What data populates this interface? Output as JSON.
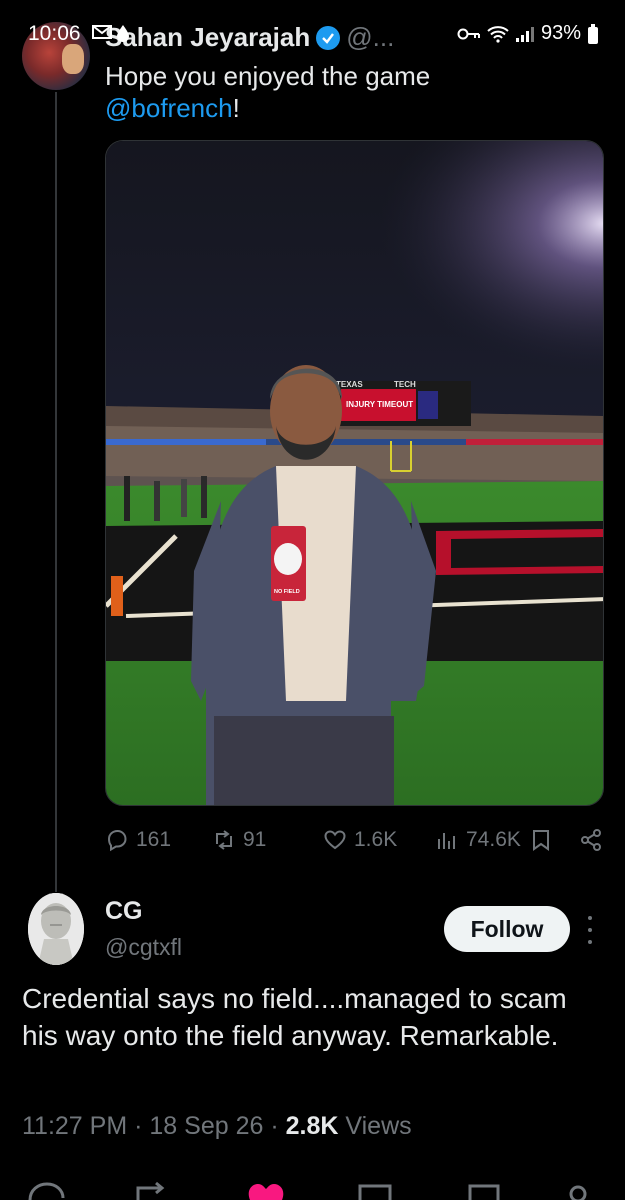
{
  "status_bar": {
    "time": "10:06",
    "battery": "93%"
  },
  "tweet": {
    "author_name": "Sahan Jeyarajah",
    "author_handle": "@...",
    "text_before": "Hope you enjoyed the game",
    "mention": "@bofrench",
    "text_after": "!",
    "photo_sign_top": "TEXAS",
    "photo_sign_right": "TECH",
    "photo_board_text": "INJURY TIMEOUT",
    "photo_credential_text": "NO FIELD",
    "stats": {
      "replies": "161",
      "retweets": "91",
      "likes": "1.6K",
      "views": "74.6K"
    }
  },
  "reply": {
    "author_name": "CG",
    "author_handle": "@cgtxfl",
    "follow_label": "Follow",
    "text": "Credential says no field....managed to scam his way onto the field anyway. Remarkable.",
    "time": "11:27 PM",
    "date": "18 Sep 26",
    "views_count": "2.8K",
    "views_label": "Views",
    "separator": "·"
  },
  "colors": {
    "background": "#000000",
    "text": "#e7e9ea",
    "muted": "#71767b",
    "link": "#1d9bf0",
    "like_pink": "#f91880"
  }
}
